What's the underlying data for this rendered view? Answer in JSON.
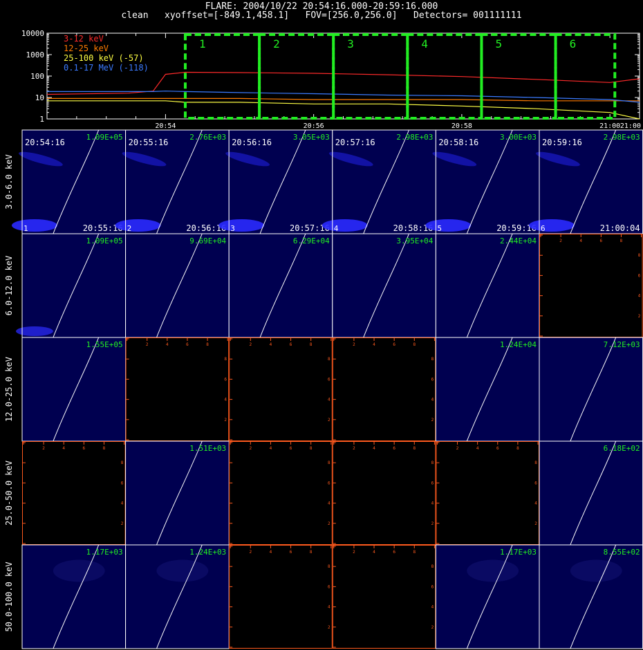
{
  "header": {
    "title_line1": "FLARE: 2004/10/22 20:54:16.000-20:59:16.000",
    "title_line2": "clean   xyoffset=[-849.1,458.1]   FOV=[256.0,256.0]   Detectors= 001111111"
  },
  "chart_data": [
    {
      "type": "line",
      "name": "lightcurve",
      "ylog": true,
      "ylim": [
        1,
        10000
      ],
      "xlim": [
        "20:52:24",
        "21:00:24"
      ],
      "xticks": [
        "20:54",
        "20:56",
        "20:58",
        "21:00"
      ],
      "yticks": [
        "1",
        "10",
        "100",
        "1000",
        "10000"
      ],
      "legend_position": "top-left",
      "x": [
        "20:52:24",
        "20:53:00",
        "20:53:30",
        "20:53:50",
        "20:54:00",
        "20:54:16",
        "20:55:00",
        "20:56:00",
        "20:57:00",
        "20:58:00",
        "20:59:00",
        "21:00:00",
        "21:00:24"
      ],
      "series": [
        {
          "name": "3-12 keV",
          "color": "#ff2a2a",
          "values": [
            14,
            15,
            16,
            20,
            120,
            150,
            145,
            135,
            115,
            95,
            70,
            50,
            75
          ]
        },
        {
          "name": "12-25 keV",
          "color": "#ff7b00",
          "values": [
            9,
            9,
            9,
            9,
            9,
            9,
            9,
            8,
            8,
            8,
            7,
            7,
            7
          ]
        },
        {
          "name": "25-100 keV (-57)",
          "color": "#ffff44",
          "values": [
            7,
            7,
            7,
            7,
            7,
            6,
            6,
            5,
            5,
            4,
            3,
            2,
            1
          ]
        },
        {
          "name": "0.1-17 MeV (-118)",
          "color": "#3b7bff",
          "values": [
            19,
            19,
            19,
            19,
            20,
            19,
            17,
            15,
            13,
            12,
            10,
            8,
            6
          ]
        }
      ],
      "intervals": [
        {
          "label": "1",
          "start": "20:54:16",
          "end": "20:55:16"
        },
        {
          "label": "2",
          "start": "20:55:16",
          "end": "20:56:16"
        },
        {
          "label": "3",
          "start": "20:56:16",
          "end": "20:57:16"
        },
        {
          "label": "4",
          "start": "20:57:16",
          "end": "20:58:16"
        },
        {
          "label": "5",
          "start": "20:58:16",
          "end": "20:59:16"
        },
        {
          "label": "6",
          "start": "20:59:16",
          "end": "21:00:04"
        }
      ],
      "interval_color": "#22ee22"
    },
    {
      "type": "heatmap",
      "name": "image-grid",
      "energy_bands": [
        "3.0-6.0 keV",
        "6.0-12.0 keV",
        "12.0-25.0 keV",
        "25.0-50.0 keV",
        "50.0-100.0 keV"
      ],
      "start_times": [
        "20:54:16",
        "20:55:16",
        "20:56:16",
        "20:57:16",
        "20:58:16",
        "20:59:16"
      ],
      "end_times": [
        "20:55:16",
        "20:56:16",
        "20:57:16",
        "20:58:16",
        "20:59:16",
        "21:00:04"
      ],
      "interval_numbers": [
        "1",
        "2",
        "3",
        "4",
        "5",
        "6"
      ],
      "panel_ticks": [
        "0",
        "2",
        "4",
        "6",
        "8",
        "10"
      ],
      "max_values": [
        [
          "1.09E+05",
          "2.76E+03",
          "3.05E+03",
          "2.98E+03",
          "3.00E+03",
          "2.98E+03"
        ],
        [
          "1.09E+05",
          "9.69E+04",
          "6.29E+04",
          "3.95E+04",
          "2.44E+04",
          null
        ],
        [
          "1.55E+05",
          null,
          null,
          null,
          "1.24E+04",
          "7.12E+03"
        ],
        [
          null,
          "1.51E+03",
          null,
          null,
          null,
          "6.18E+02"
        ],
        [
          "1.17E+03",
          "1.24E+03",
          null,
          null,
          "1.17E+03",
          "8.55E+02"
        ]
      ],
      "empty_panel_color": "#000000",
      "empty_axis_color": "#ff5a1e",
      "image_background": "#000050",
      "max_label_color": "#22ee22",
      "limb_color": "#ffffff"
    }
  ]
}
